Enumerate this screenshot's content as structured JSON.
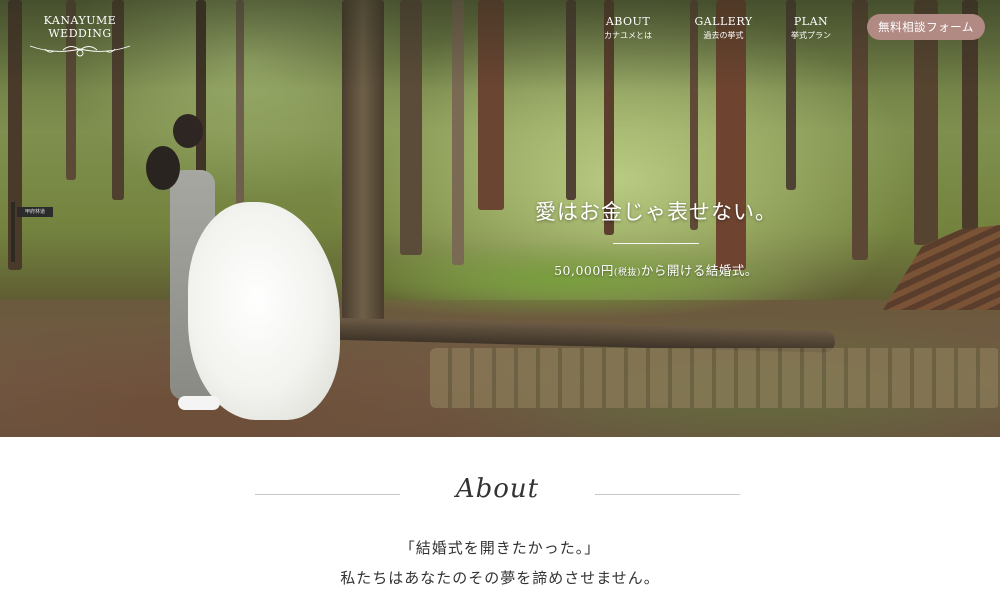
{
  "header": {
    "brand": "KANAYUME WEDDING",
    "nav": [
      {
        "en": "ABOUT",
        "ja": "カナユメとは"
      },
      {
        "en": "GALLERY",
        "ja": "過去の挙式"
      },
      {
        "en": "PLAN",
        "ja": "挙式プラン"
      }
    ],
    "cta": "無料相談フォーム"
  },
  "hero": {
    "catch": "愛はお金じゃ表せない。",
    "sub_price": "50,000円",
    "sub_tax": "(税抜)",
    "sub_rest": "から開ける結婚式。",
    "sign": "甲府林道"
  },
  "about": {
    "title": "About",
    "lines": [
      "「結婚式を開きたかった。」",
      "私たちはあなたのその夢を諦めさせません。"
    ]
  },
  "colors": {
    "cta_bg": "#b18a84",
    "text": "#333333",
    "rule": "#c8c8c8"
  },
  "icons": [
    "logo-ornament-icon"
  ]
}
